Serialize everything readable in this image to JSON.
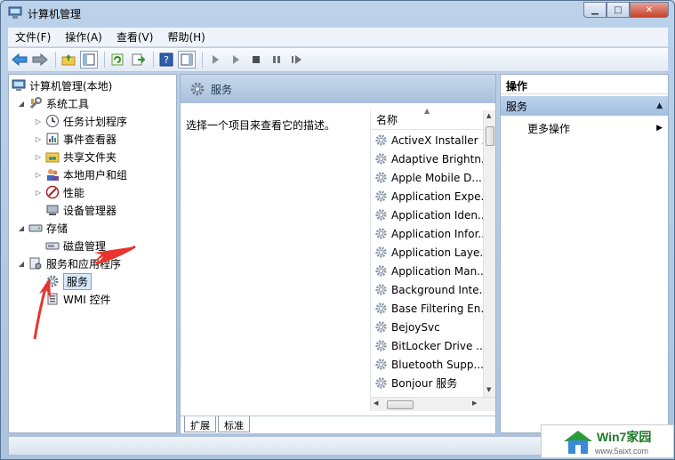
{
  "window": {
    "title": "计算机管理"
  },
  "menu": [
    {
      "id": "file",
      "label": "文件(F)"
    },
    {
      "id": "action",
      "label": "操作(A)"
    },
    {
      "id": "view",
      "label": "查看(V)"
    },
    {
      "id": "help",
      "label": "帮助(H)"
    }
  ],
  "toolbar": {
    "icons": [
      "back-icon",
      "forward-icon",
      "up-folder-icon",
      "show-hide-tree-icon",
      "refresh-icon",
      "export-list-icon",
      "help-icon",
      "show-hide-action-pane-icon",
      "start-service-icon",
      "start-service-alt-icon",
      "stop-service-icon",
      "pause-service-icon",
      "restart-service-icon"
    ]
  },
  "tree": {
    "root": "计算机管理(本地)",
    "system_tools": "系统工具",
    "task_scheduler": "任务计划程序",
    "event_viewer": "事件查看器",
    "shared_folders": "共享文件夹",
    "local_users": "本地用户和组",
    "performance": "性能",
    "device_manager": "设备管理器",
    "storage": "存储",
    "disk_management": "磁盘管理",
    "services_apps": "服务和应用程序",
    "services": "服务",
    "wmi": "WMI 控件"
  },
  "middle": {
    "header": "服务",
    "description": "选择一个项目来查看它的描述。",
    "column_name": "名称",
    "services": [
      "ActiveX Installer ...",
      "Adaptive Brightn...",
      "Apple Mobile D...",
      "Application Expe...",
      "Application Iden...",
      "Application Infor...",
      "Application Laye...",
      "Application Man...",
      "Background Inte...",
      "Base Filtering En...",
      "BejoySvc",
      "BitLocker Drive ...",
      "Bluetooth Supp...",
      "Bonjour 服务"
    ],
    "tabs": {
      "extended": "扩展",
      "standard": "标准"
    }
  },
  "actions": {
    "header": "操作",
    "section": "服务",
    "more": "更多操作"
  },
  "watermark": {
    "title": "Win7家园",
    "url": "www.5aixt.com"
  }
}
